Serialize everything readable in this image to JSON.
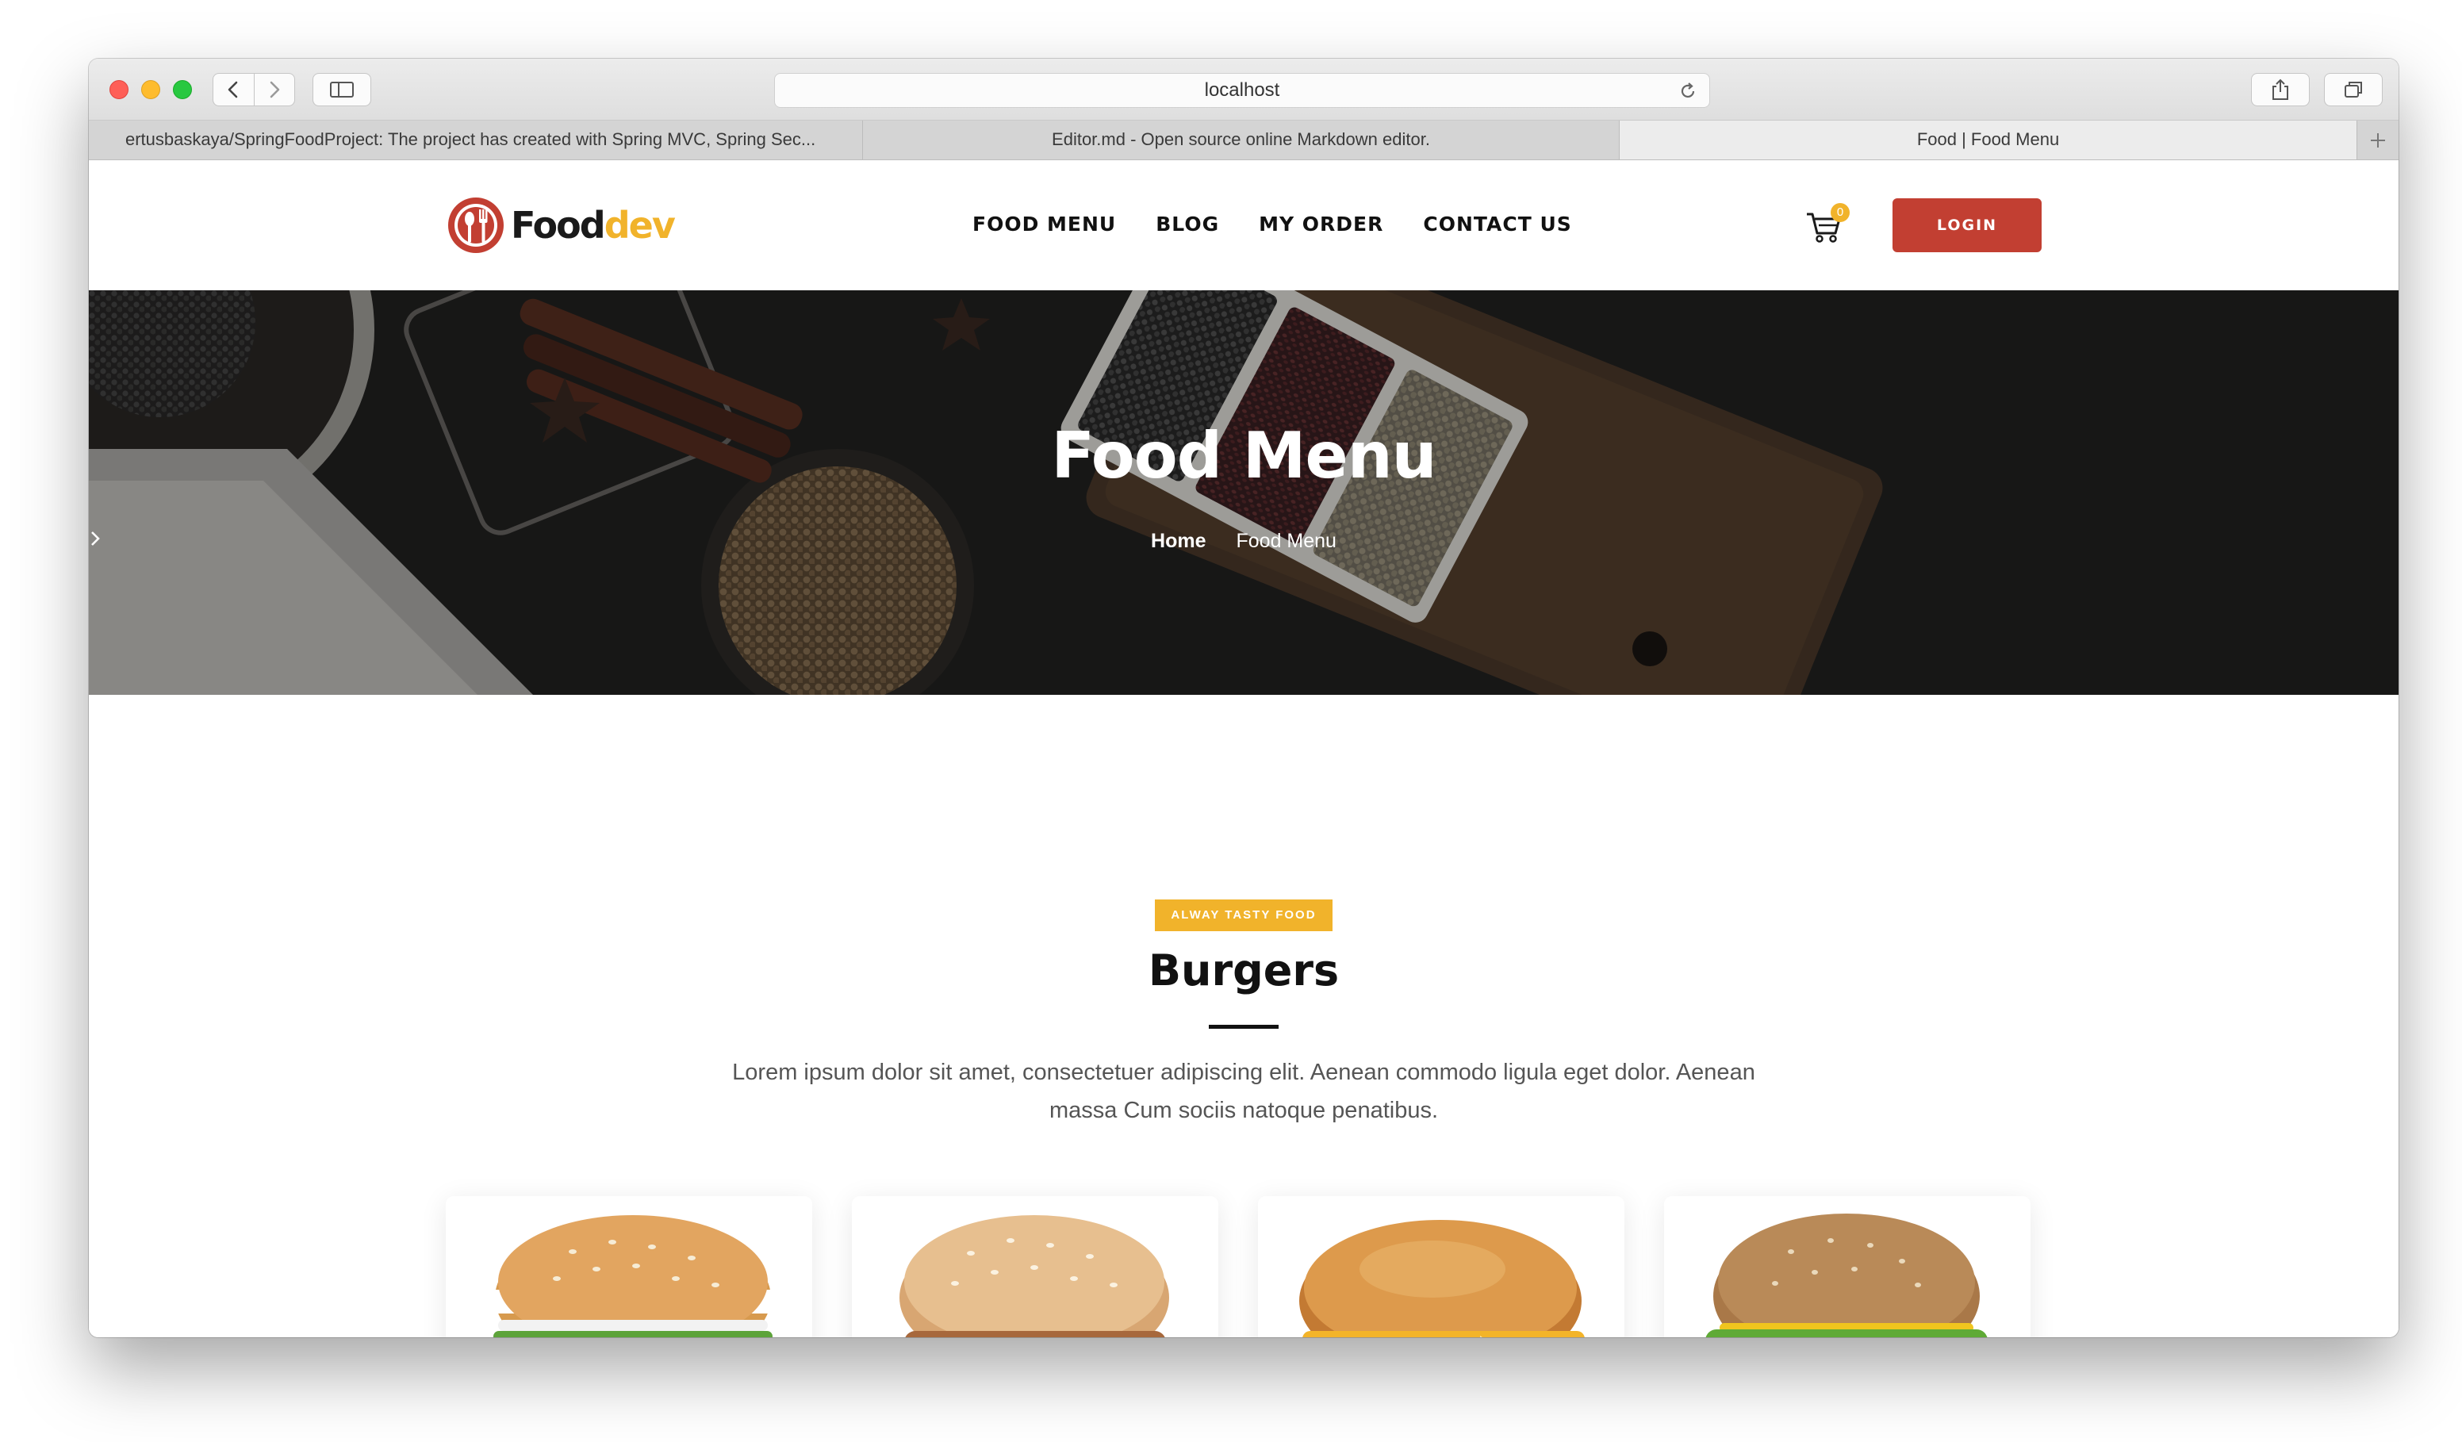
{
  "browser": {
    "url": "localhost",
    "tabs": [
      {
        "title": "ertusbaskaya/SpringFoodProject: The project has created with Spring MVC, Spring Sec..."
      },
      {
        "title": "Editor.md - Open source online Markdown editor."
      },
      {
        "title": "Food | Food Menu"
      }
    ]
  },
  "header": {
    "logo_food": "Food",
    "logo_dev": "dev",
    "nav": [
      "FOOD MENU",
      "BLOG",
      "MY ORDER",
      "CONTACT US"
    ],
    "cart_count": "0",
    "login_label": "LOGIN"
  },
  "hero": {
    "title": "Food Menu",
    "breadcrumb": [
      "Home",
      "Food Menu"
    ]
  },
  "section": {
    "tag": "ALWAY TASTY FOOD",
    "title": "Burgers",
    "description": "Lorem ipsum dolor sit amet, consectetuer adipiscing elit. Aenean commodo ligula eget dolor. Aenean massa Cum sociis natoque penatibus."
  },
  "colors": {
    "accent": "#f1b32b",
    "login": "#c23f32",
    "hero_bg": "#262524"
  },
  "icons": [
    "back-icon",
    "forward-icon",
    "sidebar-icon",
    "reload-icon",
    "share-icon",
    "tabs-icon",
    "new-tab-icon",
    "cart-icon",
    "chevron-right-icon"
  ]
}
